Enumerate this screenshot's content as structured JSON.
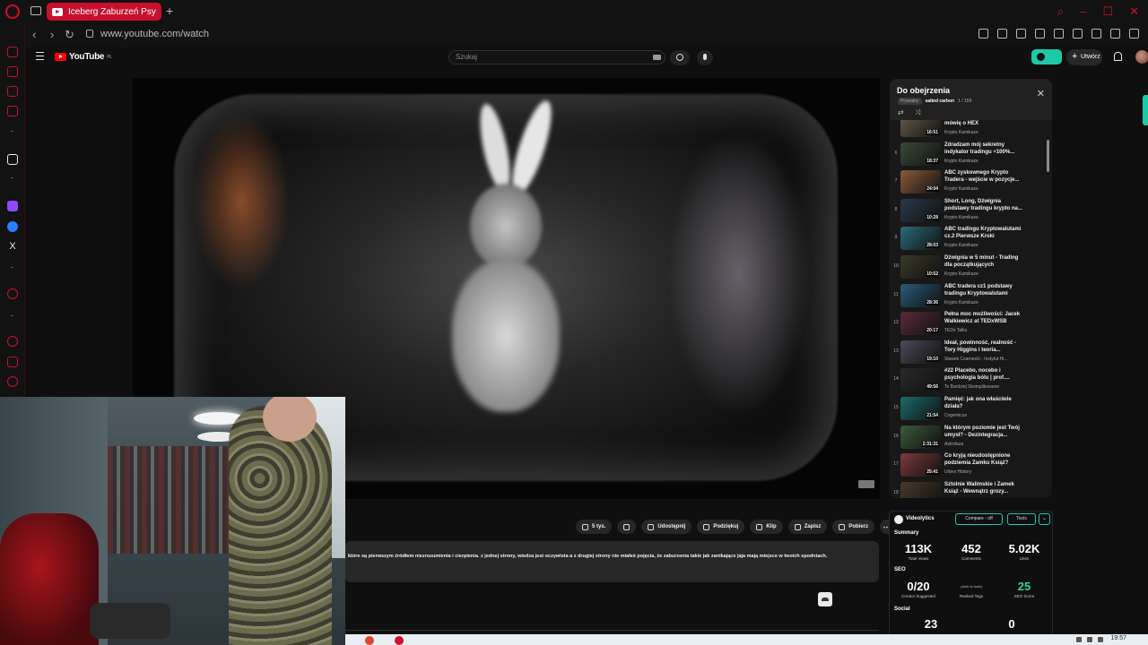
{
  "browser": {
    "tab_title": "Iceberg Zaburzeń Psy",
    "new_tab_label": "+",
    "url": "www.youtube.com/watch",
    "accent_color": "#c8102e"
  },
  "youtube": {
    "logo_text": "YouTube",
    "logo_region": "PL",
    "search_placeholder": "Szukaj",
    "create_label": "Utwórz"
  },
  "playlist": {
    "title": "Do obejrzenia",
    "privacy": "Prywatny",
    "owner": "salted carbon",
    "position": "1 / 159",
    "items": [
      {
        "num": "",
        "title": "Może nie było o HEX a cały film mówię o HEX",
        "channel": "Krypto Kamikaze",
        "duration": "16:51",
        "thumb": "#6a5a4a"
      },
      {
        "num": "6",
        "title": "Zdradzam mój sekretny indykator tradingu +100%...",
        "channel": "Krypto Kamikaze",
        "duration": "18:37",
        "thumb": "#3a4a3a"
      },
      {
        "num": "7",
        "title": "ABC zyskownego Krypto Tradera - wejście w pozycje...",
        "channel": "Krypto Kamikaze",
        "duration": "24:04",
        "thumb": "#8a5a3a"
      },
      {
        "num": "8",
        "title": "Short, Long, Dźwignia podstawy tradingu krypto na...",
        "channel": "Krypto Kamikaze",
        "duration": "10:28",
        "thumb": "#2a3a4a"
      },
      {
        "num": "9",
        "title": "ABC tradingu Kryptowalutami cz.2 Pierwsze Kroki",
        "channel": "Krypto Kamikaze",
        "duration": "28:03",
        "thumb": "#2a6a7a"
      },
      {
        "num": "10",
        "title": "Dźwignia w 5 minut - Trading dla początkujących",
        "channel": "Krypto Kamikaze",
        "duration": "10:52",
        "thumb": "#3a3a2a"
      },
      {
        "num": "11",
        "title": "ABC tradera cz1 podstawy tradingu Kryptowalutami",
        "channel": "Krypto Kamikaze",
        "duration": "28:36",
        "thumb": "#2a5a7a"
      },
      {
        "num": "12",
        "title": "Pełna moc możliwości: Jacek Walkiewicz at TEDxWSB",
        "channel": "TEDx Talks",
        "duration": "20:17",
        "thumb": "#5a2a3a"
      },
      {
        "num": "13",
        "title": "Ideał, powinność, realność - Tory Higgins i teoria...",
        "channel": "Sławek Czarnecki - Instytut Hi...",
        "duration": "19:10",
        "thumb": "#4a4a5a"
      },
      {
        "num": "14",
        "title": "#22 Placebo, nocebo i psychologia bólu | prof....",
        "channel": "To Bardziej Skomplikowane",
        "duration": "49:56",
        "thumb": "#2a2a2a"
      },
      {
        "num": "15",
        "title": "Pamięć: jak ona właściwie działa?",
        "channel": "Cogemicus",
        "duration": "21:54",
        "thumb": "#1a6a6a"
      },
      {
        "num": "16",
        "title": "Na którym poziomie jest Twój umysł? - Dezintegracja...",
        "channel": "Astrofaza",
        "duration": "2:31:31",
        "thumb": "#3a5a3a"
      },
      {
        "num": "17",
        "title": "Co kryją nieudostępnione podziemia Zamku Książ?",
        "channel": "Urbex History",
        "duration": "25:41",
        "thumb": "#7a3a3a"
      },
      {
        "num": "18",
        "title": "Sztolnie Walimskie i Zamek Książ - Wewnątrz grozy...",
        "channel": "",
        "duration": "",
        "thumb": "#4a3a2a"
      }
    ]
  },
  "actions": {
    "like_count": "5 tys.",
    "share": "Udostępnij",
    "thanks": "Podziękuj",
    "clip": "Klip",
    "save": "Zapisz",
    "download": "Pobierz",
    "more": "⋯"
  },
  "description": {
    "text": "które są pierwszym źródłem niezrozumienia i cierpienia.  z jednej strony, wiedza  jest oczywista a z drugiej strony nie miałeś pojęcia, że zaburzenia takie jak zanikające jaja mają miejsce w twoich spodniach."
  },
  "videolytics": {
    "name": "Videolytics",
    "compare": "Compare - off",
    "tools": "Tools",
    "caret": "⌄",
    "summary_label": "Summary",
    "total_views": "113K",
    "total_views_label": "Total Views",
    "comments": "452",
    "comments_label": "Comments",
    "likes": "5.02K",
    "likes_label": "Likes",
    "seo_label": "SEO",
    "creator_suggested": "0/20",
    "creator_suggested_label": "Creator Suggested",
    "ranked_tags_hint": "(click to load)",
    "ranked_tags_label": "Ranked Tags",
    "seo_score": "25",
    "seo_score_label": "SEO Score",
    "social_label": "Social",
    "social_a": "23",
    "social_b": "0"
  },
  "taskbar": {
    "clock": "19:57"
  }
}
